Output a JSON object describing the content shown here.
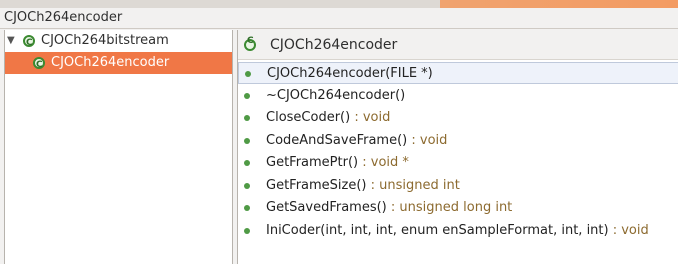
{
  "window": {
    "title": "CJOCh264encoder"
  },
  "tree": {
    "root": {
      "label": "CJOCh264bitstream",
      "expanded_icon": "triangle-down-icon",
      "icon": "class-icon"
    },
    "selected_child": {
      "label": "CJOCh264encoder",
      "icon": "class-icon"
    }
  },
  "detail": {
    "header_label": "CJOCh264encoder",
    "members": [
      {
        "name": "CJOCh264encoder(FILE *)",
        "type": ""
      },
      {
        "name": "~CJOCh264encoder()",
        "type": ""
      },
      {
        "name": "CloseCoder()",
        "type": " : void"
      },
      {
        "name": "CodeAndSaveFrame()",
        "type": " : void"
      },
      {
        "name": "GetFramePtr()",
        "type": " : void *"
      },
      {
        "name": "GetFrameSize()",
        "type": " : unsigned int"
      },
      {
        "name": "GetSavedFrames()",
        "type": " : unsigned long int"
      },
      {
        "name": "IniCoder(int, int, int, enum enSampleFormat, int, int)",
        "type": " : void"
      }
    ]
  },
  "colors": {
    "selection_orange": "#f07746",
    "method_dot": "#4f9a45",
    "type_color": "#8c6a2f"
  }
}
